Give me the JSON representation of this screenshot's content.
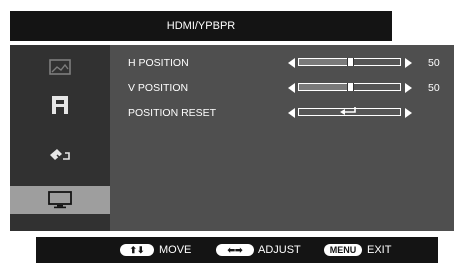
{
  "header": {
    "title": "HDMI/YPBPR"
  },
  "sidebar": {
    "items": [
      {
        "icon": "picture-icon",
        "active": false
      },
      {
        "icon": "color-icon",
        "active": false
      },
      {
        "icon": "osd-settings-icon",
        "active": false
      },
      {
        "icon": "monitor-icon",
        "active": true
      }
    ]
  },
  "menu": {
    "h_position": {
      "label": "H POSITION",
      "value": "50",
      "level": 0.5
    },
    "v_position": {
      "label": "V POSITION",
      "value": "50",
      "level": 0.5
    },
    "position_reset": {
      "label": "POSITION RESET",
      "icon": "enter-icon"
    }
  },
  "footer": {
    "move_key": "⬆⬇",
    "move_label": "MOVE",
    "adjust_key": "⬅➡",
    "adjust_label": "ADJUST",
    "menu_key": "MENU",
    "exit_label": "EXIT"
  }
}
